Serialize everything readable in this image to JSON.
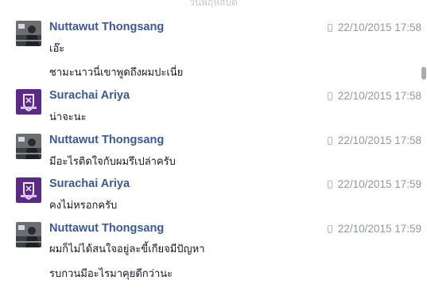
{
  "top_partial_label": "วันพฤหัสบดี",
  "colors": {
    "sender_name": "#3b5998",
    "timestamp": "#9197a3",
    "message_text": "#141823"
  },
  "messages": [
    {
      "sender": "Nuttawut Thongsang",
      "timestamp": "22/10/2015 17:58",
      "source_icon": "mobile-phone-icon",
      "avatar": "nuttawut-avatar",
      "lines": [
        "เอ๊ะ",
        "ชามะนาวนี่เขาพูดถึงผมปะเนี่ย"
      ]
    },
    {
      "sender": "Surachai Ariya",
      "timestamp": "22/10/2015 17:58",
      "source_icon": "mobile-phone-icon",
      "avatar": "surachai-avatar",
      "lines": [
        "น่าจะนะ"
      ]
    },
    {
      "sender": "Nuttawut Thongsang",
      "timestamp": "22/10/2015 17:58",
      "source_icon": "mobile-phone-icon",
      "avatar": "nuttawut-avatar",
      "lines": [
        "มีอะไรติดใจกับผมรึเปล่าครับ"
      ]
    },
    {
      "sender": "Surachai Ariya",
      "timestamp": "22/10/2015 17:59",
      "source_icon": "mobile-phone-icon",
      "avatar": "surachai-avatar",
      "lines": [
        "คงไม่หรอกครับ"
      ]
    },
    {
      "sender": "Nuttawut Thongsang",
      "timestamp": "22/10/2015 17:59",
      "source_icon": "mobile-phone-icon",
      "avatar": "nuttawut-avatar",
      "lines": [
        "ผมก็ไม่ได้สนใจอยู่ละขี้เกียจมีปัญหา",
        "รบกวนมีอะไรมาคุยดีกว่านะ"
      ]
    }
  ]
}
